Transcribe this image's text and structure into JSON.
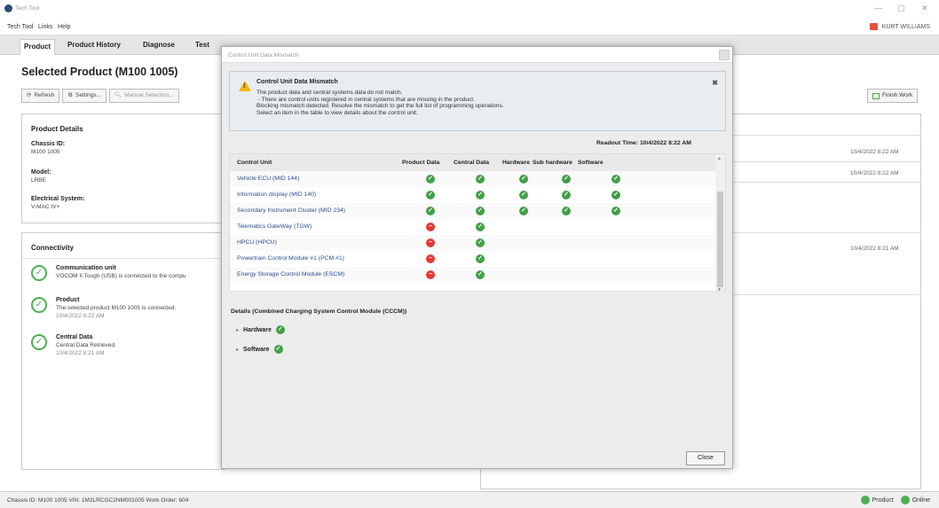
{
  "app": {
    "title": "Tech Tool",
    "menu": [
      "Tech Tool",
      "Links",
      "Help"
    ],
    "user": "KURT WILLIAMS"
  },
  "tabs": [
    "Product",
    "Product History",
    "Diagnose",
    "Test"
  ],
  "page": {
    "title": "Selected Product (M100 1005)",
    "toolbar": {
      "refresh": "Refresh",
      "settings": "Settings...",
      "manual_selection": "Manual Selection...",
      "finish_work": "Finish Work"
    }
  },
  "product_details": {
    "title": "Product Details",
    "chassis_label": "Chassis ID:",
    "chassis_value": "M100 1005",
    "model_label": "Model:",
    "model_value": "LRBE",
    "electrical_label": "Electrical System:",
    "electrical_value": "V-MAC IV+"
  },
  "connectivity": {
    "title": "Connectivity",
    "items": [
      {
        "title": "Communication unit",
        "text": "VOCOM II Tough (USB) is connected to the compu",
        "time": ""
      },
      {
        "title": "Product",
        "text": "The selected product M100 1005 is connected.",
        "time": "10/4/2022 8:22 AM"
      },
      {
        "title": "Central Data",
        "text": "Central Data Retrieved.",
        "time": "10/4/2022 8:21 AM"
      }
    ]
  },
  "right_times": [
    "10/4/2022 8:22 AM",
    "10/4/2022 8:22 AM",
    "10/4/2022 8:21 AM"
  ],
  "statusbar": {
    "left": "Chassis ID: M100 1005   VIN: 1M2LRCGC2NM001005   Work Order: 604",
    "product": "Product",
    "online": "Online"
  },
  "modal": {
    "window_title": "Control Unit Data Mismatch",
    "alert_title": "Control Unit Data Mismatch",
    "alert_lines": [
      "The product data and central systems data do not match.",
      " - There are control units registered in central systems that are missing in the product.",
      "Blocking mismatch detected.  Resolve the mismatch to get the full list of programming operations.",
      "Select an item in the table to view details about the control unit."
    ],
    "readout": "Readout Time:  10/4/2022 8:22 AM",
    "columns": [
      "Control Unit",
      "Product Data",
      "Central Data",
      "Hardware",
      "Sub hardware",
      "Software"
    ],
    "rows": [
      {
        "name": "Vehicle ECU (MID 144)",
        "status": [
          "ok",
          "ok",
          "ok",
          "ok",
          "ok"
        ]
      },
      {
        "name": "Information display (MID 140)",
        "status": [
          "ok",
          "ok",
          "ok",
          "ok",
          "ok"
        ]
      },
      {
        "name": "Secondary Instrument Cluster (MID 234)",
        "status": [
          "ok",
          "ok",
          "ok",
          "ok",
          "ok"
        ]
      },
      {
        "name": "Telematics GateWay (TGW)",
        "status": [
          "err",
          "ok",
          "",
          "",
          ""
        ]
      },
      {
        "name": "HPCU (HPCU)",
        "status": [
          "err",
          "ok",
          "",
          "",
          ""
        ]
      },
      {
        "name": "Powertrain Control Module #1 (PCM #1)",
        "status": [
          "err",
          "ok",
          "",
          "",
          ""
        ]
      },
      {
        "name": "Energy Storage Control Module (ESCM)",
        "status": [
          "err",
          "ok",
          "",
          "",
          ""
        ]
      }
    ],
    "details_title": "Details (Combined Charging System Control Module (CCCM))",
    "details_items": [
      "Hardware",
      "Software"
    ],
    "close": "Close"
  },
  "colors": {
    "ok": "#43a047",
    "err": "#e53935",
    "link": "#2a4d8f",
    "warning": "#f2b705"
  },
  "icons": [
    "app-logo-icon",
    "minimize-icon",
    "restore-icon",
    "close-icon",
    "user-icon",
    "refresh-icon",
    "settings-icon",
    "search-icon",
    "finish-icon",
    "warning-icon",
    "check-icon",
    "error-icon"
  ]
}
